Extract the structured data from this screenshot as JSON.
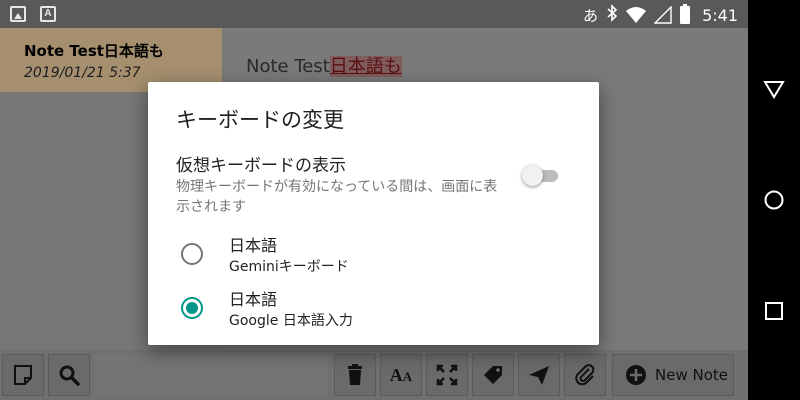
{
  "status_bar": {
    "ime_indicator": "あ",
    "time": "5:41",
    "icons": [
      "image-notification-icon",
      "keyboard-notification-icon",
      "bluetooth-icon",
      "wifi-icon",
      "signal-icon",
      "battery-icon"
    ]
  },
  "notification_text_icon": "A",
  "note_list": {
    "items": [
      {
        "title": "Note Test日本語も",
        "date": "2019/01/21 5:37"
      }
    ]
  },
  "editor": {
    "text_plain": "Note Test",
    "text_composing": "日本語も"
  },
  "toolbar": {
    "new_note_label": "New Note",
    "font_label": "A",
    "font_label_small": "A"
  },
  "dialog": {
    "title": "キーボードの変更",
    "virtual_keyboard_title": "仮想キーボードの表示",
    "virtual_keyboard_summary": "物理キーボードが有効になっている間は、画面に表示されます",
    "virtual_keyboard_enabled": false,
    "options": [
      {
        "name": "日本語",
        "subtitle": "Geminiキーボード",
        "selected": false
      },
      {
        "name": "日本語",
        "subtitle": "Google 日本語入力",
        "selected": true
      }
    ]
  },
  "colors": {
    "accent": "#009688",
    "note_card": "#a58f6f",
    "scrim_app": "#7a7a7a"
  }
}
